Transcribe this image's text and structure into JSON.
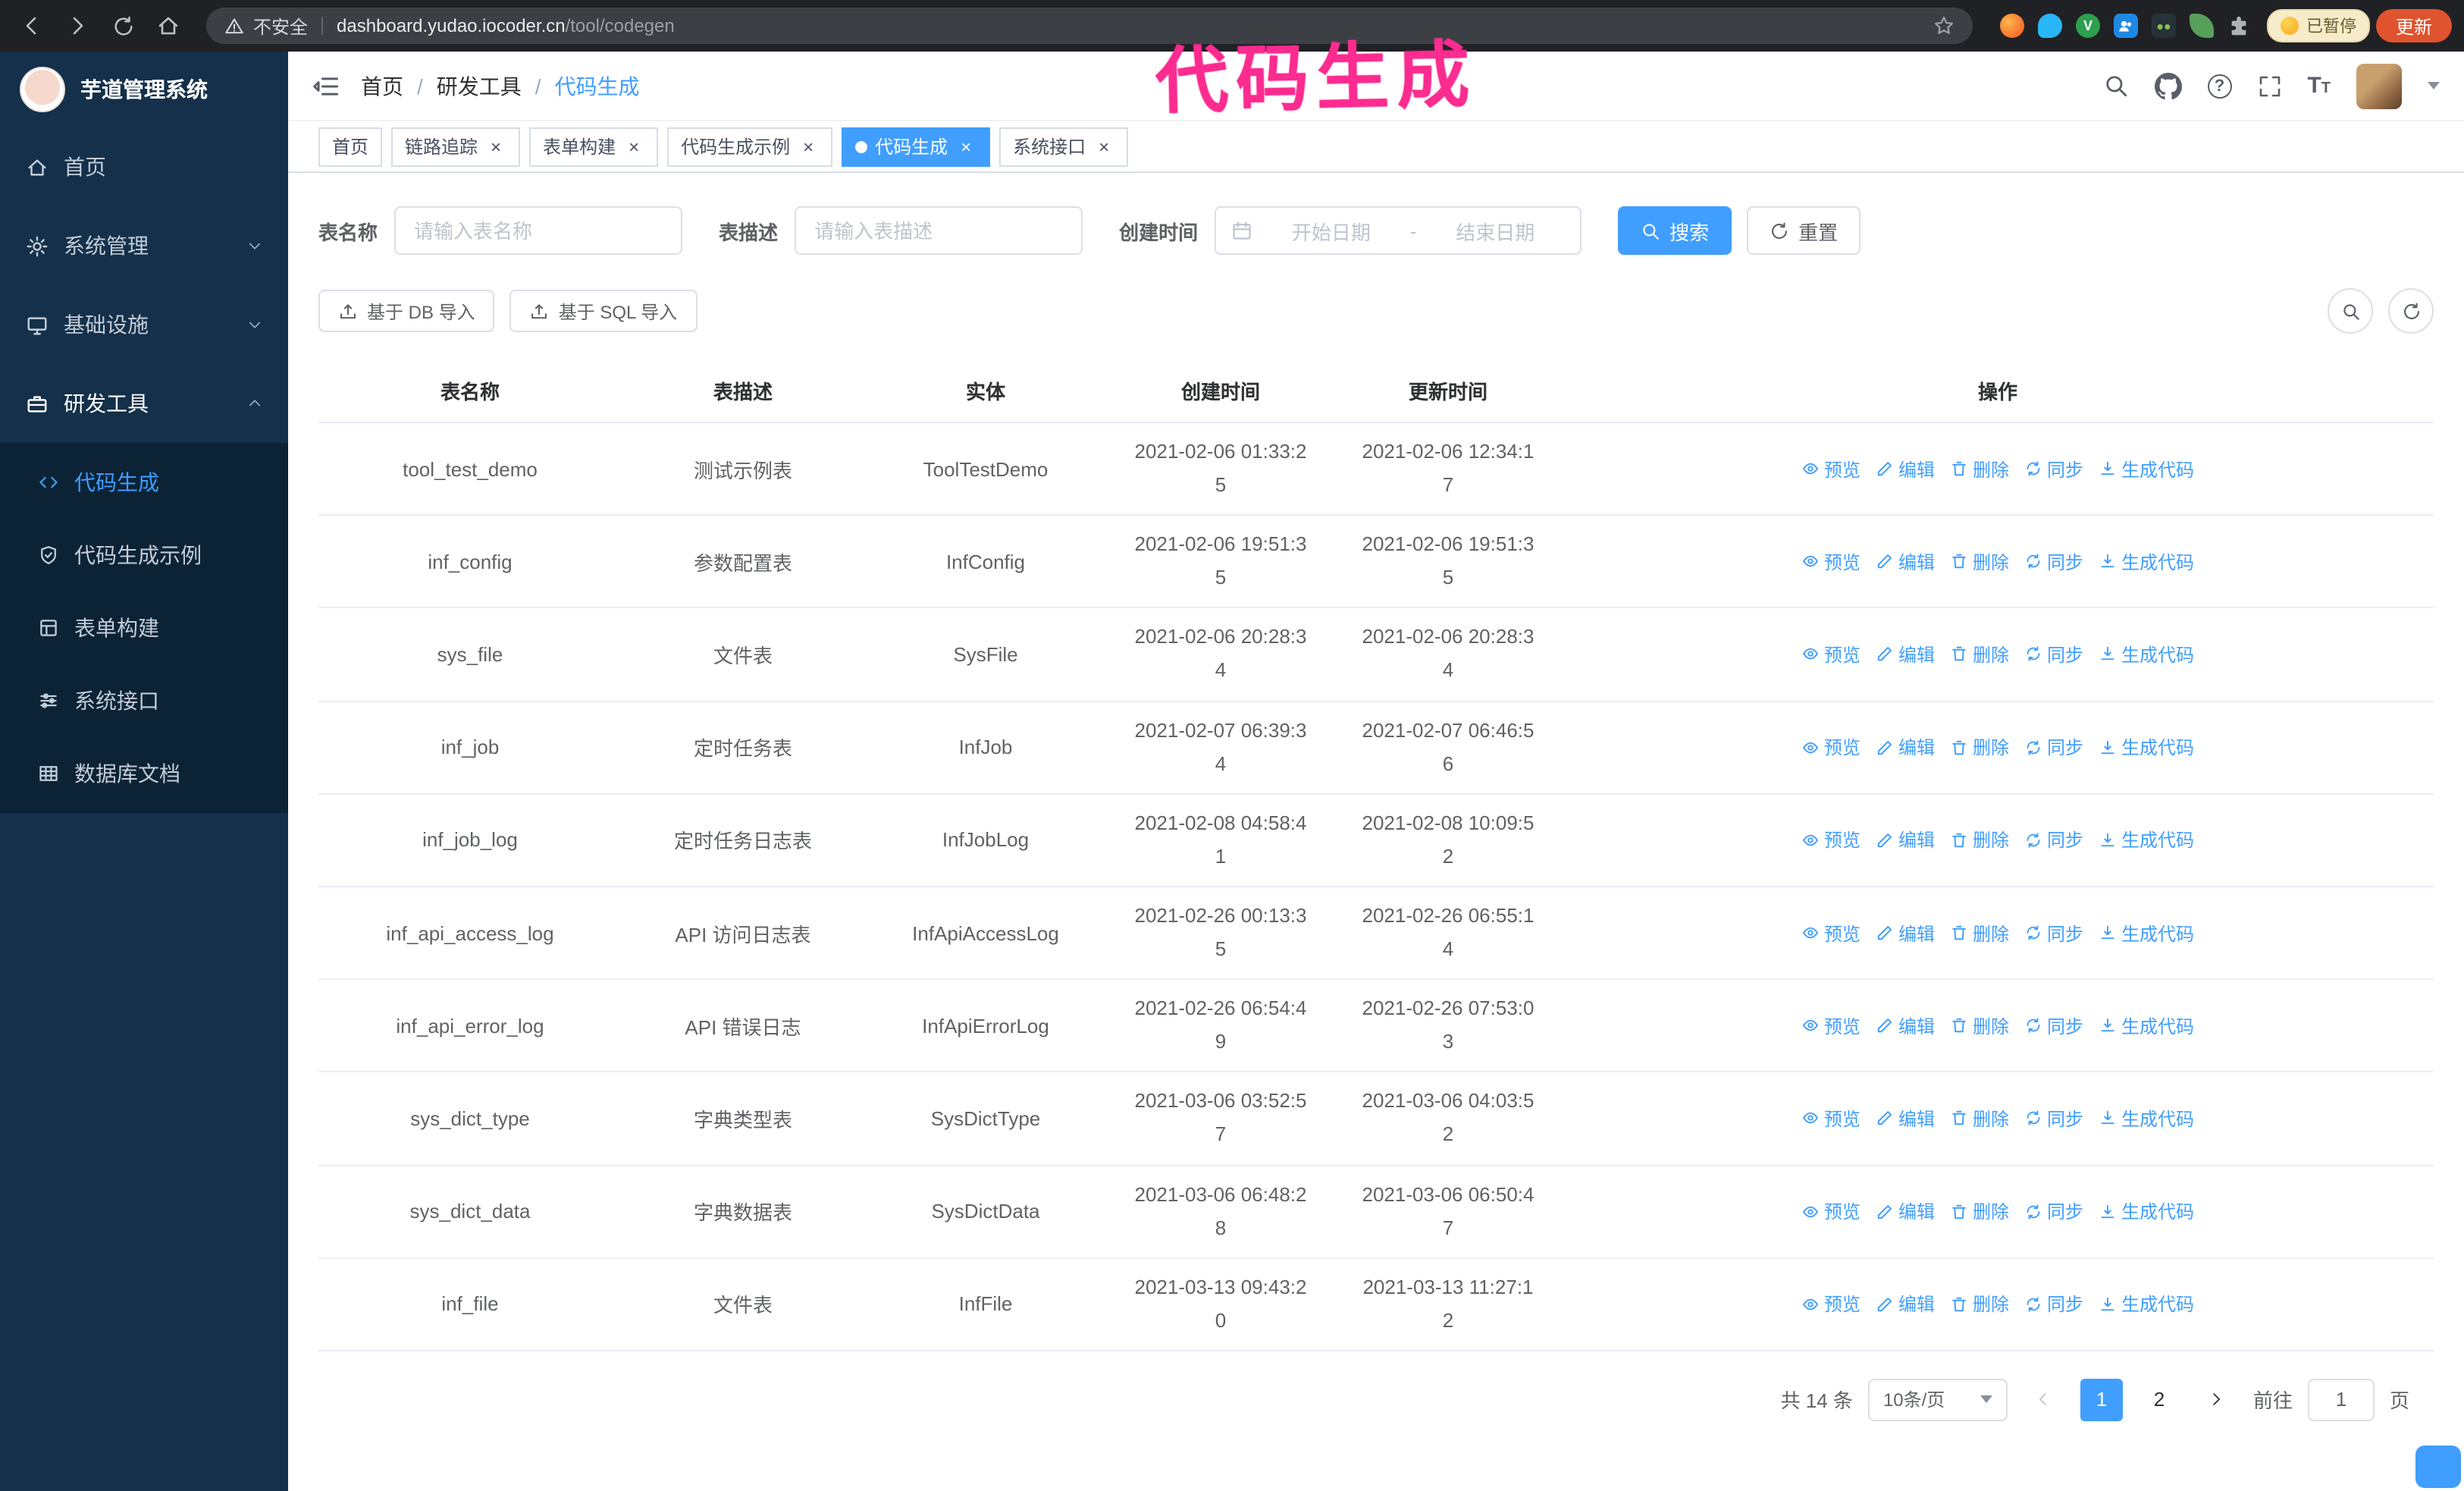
{
  "browser": {
    "security_label": "不安全",
    "url_domain": "dashboard.yudao.iocoder.cn",
    "url_path": "/tool/codegen",
    "paused_badge": "已暂停",
    "update_button": "更新"
  },
  "annotation": {
    "text": "代码生成"
  },
  "sidebar": {
    "logo_title": "芋道管理系统",
    "items": [
      {
        "label": "首页"
      },
      {
        "label": "系统管理"
      },
      {
        "label": "基础设施"
      },
      {
        "label": "研发工具"
      }
    ],
    "submenu": [
      {
        "label": "代码生成"
      },
      {
        "label": "代码生成示例"
      },
      {
        "label": "表单构建"
      },
      {
        "label": "系统接口"
      },
      {
        "label": "数据库文档"
      }
    ]
  },
  "header": {
    "breadcrumb": [
      "首页",
      "研发工具",
      "代码生成"
    ]
  },
  "tabs": [
    {
      "label": "首页"
    },
    {
      "label": "链路追踪"
    },
    {
      "label": "表单构建"
    },
    {
      "label": "代码生成示例"
    },
    {
      "label": "代码生成"
    },
    {
      "label": "系统接口"
    }
  ],
  "filters": {
    "table_name_label": "表名称",
    "table_name_placeholder": "请输入表名称",
    "table_desc_label": "表描述",
    "table_desc_placeholder": "请输入表描述",
    "create_time_label": "创建时间",
    "date_start_placeholder": "开始日期",
    "date_separator": "-",
    "date_end_placeholder": "结束日期",
    "search_button": "搜索",
    "reset_button": "重置"
  },
  "toolbar": {
    "import_db_button": "基于 DB 导入",
    "import_sql_button": "基于 SQL 导入"
  },
  "table": {
    "columns": [
      "表名称",
      "表描述",
      "实体",
      "创建时间",
      "更新时间",
      "操作"
    ],
    "actions": [
      "预览",
      "编辑",
      "删除",
      "同步",
      "生成代码"
    ],
    "rows": [
      {
        "name": "tool_test_demo",
        "desc": "测试示例表",
        "entity": "ToolTestDemo",
        "created": "2021-02-06 01:33:25",
        "updated": "2021-02-06 12:34:17"
      },
      {
        "name": "inf_config",
        "desc": "参数配置表",
        "entity": "InfConfig",
        "created": "2021-02-06 19:51:35",
        "updated": "2021-02-06 19:51:35"
      },
      {
        "name": "sys_file",
        "desc": "文件表",
        "entity": "SysFile",
        "created": "2021-02-06 20:28:34",
        "updated": "2021-02-06 20:28:34"
      },
      {
        "name": "inf_job",
        "desc": "定时任务表",
        "entity": "InfJob",
        "created": "2021-02-07 06:39:34",
        "updated": "2021-02-07 06:46:56"
      },
      {
        "name": "inf_job_log",
        "desc": "定时任务日志表",
        "entity": "InfJobLog",
        "created": "2021-02-08 04:58:41",
        "updated": "2021-02-08 10:09:52"
      },
      {
        "name": "inf_api_access_log",
        "desc": "API 访问日志表",
        "entity": "InfApiAccessLog",
        "created": "2021-02-26 00:13:35",
        "updated": "2021-02-26 06:55:14"
      },
      {
        "name": "inf_api_error_log",
        "desc": "API 错误日志",
        "entity": "InfApiErrorLog",
        "created": "2021-02-26 06:54:49",
        "updated": "2021-02-26 07:53:03"
      },
      {
        "name": "sys_dict_type",
        "desc": "字典类型表",
        "entity": "SysDictType",
        "created": "2021-03-06 03:52:57",
        "updated": "2021-03-06 04:03:52"
      },
      {
        "name": "sys_dict_data",
        "desc": "字典数据表",
        "entity": "SysDictData",
        "created": "2021-03-06 06:48:28",
        "updated": "2021-03-06 06:50:47"
      },
      {
        "name": "inf_file",
        "desc": "文件表",
        "entity": "InfFile",
        "created": "2021-03-13 09:43:20",
        "updated": "2021-03-13 11:27:12"
      }
    ]
  },
  "pagination": {
    "total_text": "共 14 条",
    "page_size": "10条/页",
    "page_1": "1",
    "page_2": "2",
    "goto_label": "前往",
    "goto_value": "1",
    "goto_suffix": "页"
  },
  "colors": {
    "accent": "#409eff",
    "annotation_pink": "#fb2b90",
    "sidebar_bg": "#14304a",
    "submenu_bg": "#0c2336",
    "update_button_bg": "#e0532f"
  }
}
